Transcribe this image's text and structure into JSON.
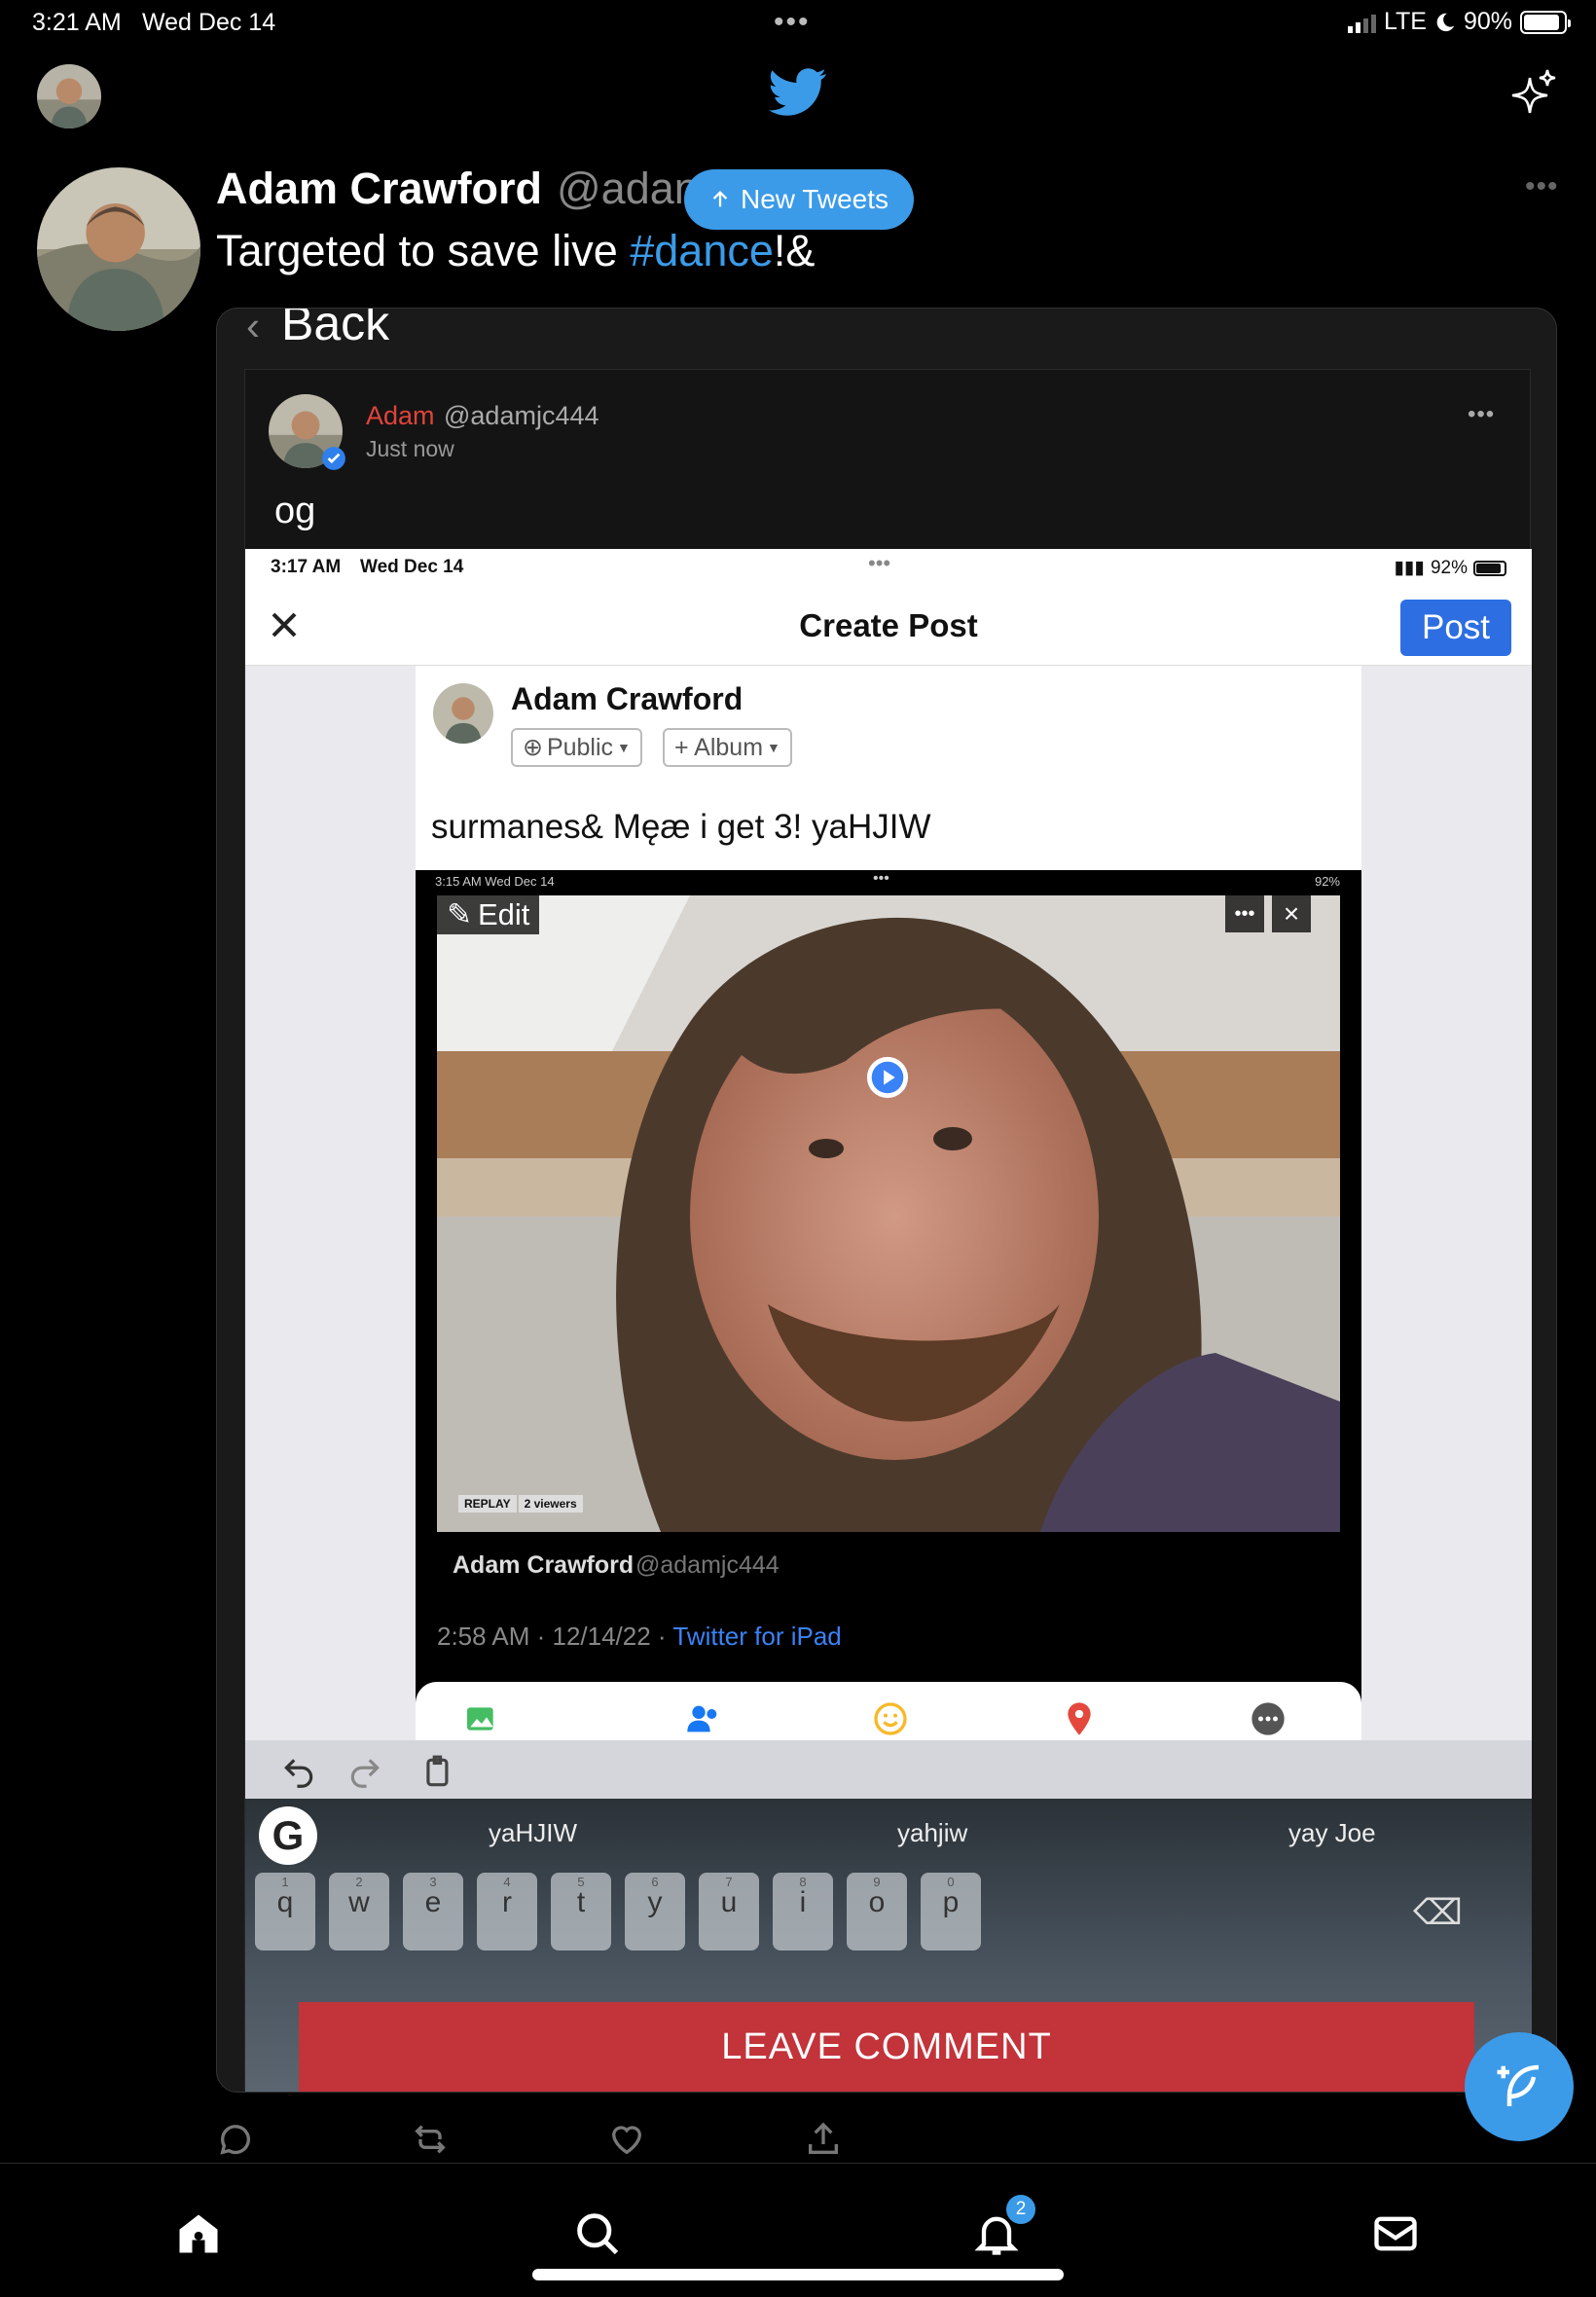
{
  "status_bar": {
    "time": "3:21 AM",
    "date": "Wed Dec 14",
    "network": "LTE",
    "battery": "90%",
    "battery_level": 0.9
  },
  "tweet": {
    "name": "Adam Crawford",
    "handle": "@adan",
    "text_before": "Targeted to save live ",
    "hashtag": "#dance",
    "text_after": "!&",
    "new_tweets_label": "New Tweets",
    "more": "•••"
  },
  "embed": {
    "back_label": "Back",
    "post": {
      "name": "Adam",
      "handle": "@adamjc444",
      "time": "Just now",
      "text": "og",
      "more": "•••"
    },
    "screenshot": {
      "status_time": "3:17 AM",
      "status_date": "Wed Dec 14",
      "battery": "92%",
      "title": "Create Post",
      "post_button": "Post",
      "author": "Adam Crawford",
      "privacy": "Public",
      "album": "+ Album",
      "text": "surmanes& Męæ i get 3! yaHJIW",
      "inner_status": "3:15 AM   Wed Dec 14",
      "inner_battery": "92%",
      "edit_label": "Edit",
      "replay": "REPLAY",
      "viewers": "2 viewers",
      "video_author": "Adam Crawford",
      "video_handle": "@adamjc444",
      "video_time": "2:58 AM · 12/14/22 · ",
      "video_source": "Twitter for iPad",
      "suggestions": [
        "yaHJIW",
        "yahjiw",
        "yay Joe"
      ],
      "keys": [
        "q",
        "w",
        "e",
        "r",
        "t",
        "y",
        "u",
        "i",
        "o",
        "p"
      ],
      "key_numbers": [
        "1",
        "2",
        "3",
        "4",
        "5",
        "6",
        "7",
        "8",
        "9",
        "0"
      ]
    }
  },
  "leave_comment": "LEAVE COMMENT",
  "notifications_count": "2",
  "colors": {
    "twitter_blue": "#3b9be8",
    "leave_comment_red": "#c2333a",
    "fb_post_blue": "#2d6ee2"
  }
}
